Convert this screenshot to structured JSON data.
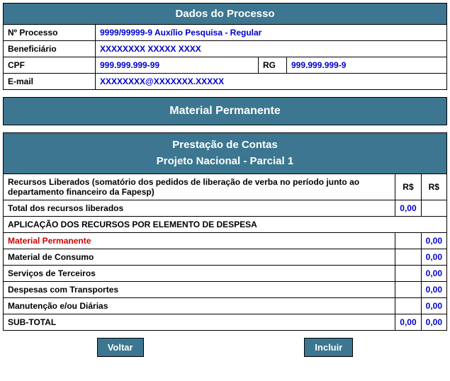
{
  "process": {
    "header": "Dados do Processo",
    "labels": {
      "numero": "Nº Processo",
      "beneficiario": "Beneficiário",
      "cpf": "CPF",
      "rg": "RG",
      "email": "E-mail"
    },
    "values": {
      "numero": "9999/99999-9 Auxílio Pesquisa - Regular",
      "beneficiario": "XXXXXXXX XXXXX XXXX",
      "cpf": "999.999.999-99",
      "rg": "999.999.999-9",
      "email": "XXXXXXXX@XXXXXXX.XXXXX"
    }
  },
  "material_header": "Material Permanente",
  "accounts": {
    "title": "Prestação de Contas",
    "subtitle": "Projeto Nacional - Parcial 1",
    "col_r1": "R$",
    "col_r2": "R$",
    "rows": {
      "recursos_liberados": "Recursos Liberados (somatório dos pedidos de liberação de verba no período junto ao departamento financeiro da Fapesp)",
      "total_recursos": "Total dos recursos liberados",
      "aplicacao_section": "APLICAÇÃO DOS RECURSOS POR ELEMENTO DE DESPESA",
      "material_permanente": "Material Permanente",
      "material_consumo": "Material de Consumo",
      "servicos_terceiros": "Serviços de Terceiros",
      "despesas_transportes": "Despesas com Transportes",
      "manutencao_diarias": "Manutenção e/ou Diárias",
      "subtotal": "SUB-TOTAL"
    },
    "values": {
      "total_recursos_r1": "0,00",
      "material_permanente_r2": "0,00",
      "material_consumo_r2": "0,00",
      "servicos_terceiros_r2": "0,00",
      "despesas_transportes_r2": "0,00",
      "manutencao_diarias_r2": "0,00",
      "subtotal_r1": "0,00",
      "subtotal_r2": "0,00"
    }
  },
  "buttons": {
    "voltar": "Voltar",
    "incluir": "Incluir"
  }
}
